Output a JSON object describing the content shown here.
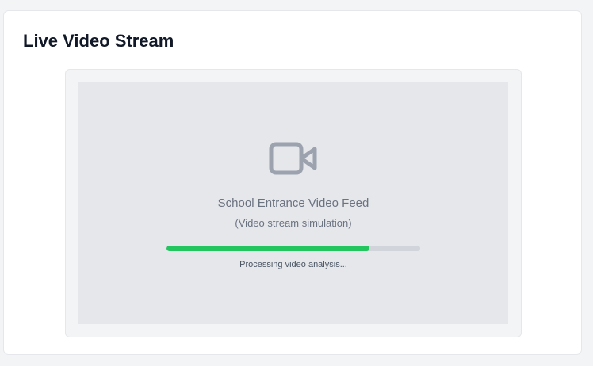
{
  "card": {
    "title": "Live Video Stream"
  },
  "video": {
    "icon": "video-camera-icon",
    "feed_title": "School Entrance Video Feed",
    "feed_subtitle": "(Video stream simulation)",
    "progress": {
      "percent": 80,
      "label": "Processing video analysis...",
      "color": "#22c55e"
    }
  }
}
